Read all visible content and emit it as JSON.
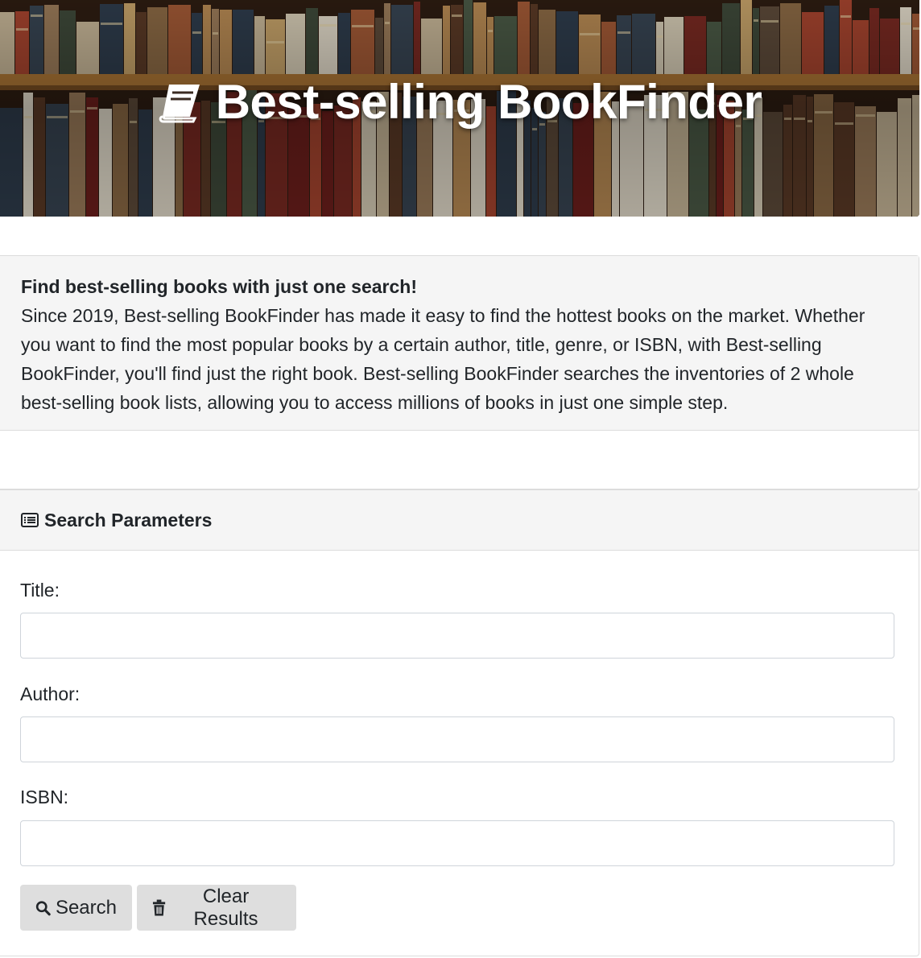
{
  "hero": {
    "title": "Best-selling BookFinder",
    "icon": "book-icon"
  },
  "intro": {
    "heading": "Find best-selling books with just one search!",
    "body": "Since 2019, Best-selling BookFinder has made it easy to find the hottest books on the market. Whether you want to find the most popular books by a certain author, title, genre, or ISBN, with Best-selling BookFinder, you'll find just the right book. Best-selling BookFinder searches the inventories of 2 whole best-selling book lists, allowing you to access millions of books in just one simple step."
  },
  "search": {
    "header_icon": "list-icon",
    "header_title": "Search Parameters",
    "fields": {
      "title_label": "Title:",
      "title_value": "",
      "author_label": "Author:",
      "author_value": "",
      "isbn_label": "ISBN:",
      "isbn_value": ""
    },
    "buttons": {
      "search_label": "Search",
      "search_icon": "search-icon",
      "clear_label": "Clear Results",
      "clear_icon": "trash-icon"
    }
  },
  "colors": {
    "panel_bg": "#f5f5f5",
    "button_bg": "#dedede",
    "border": "#dcdcdc",
    "text": "#212529"
  }
}
